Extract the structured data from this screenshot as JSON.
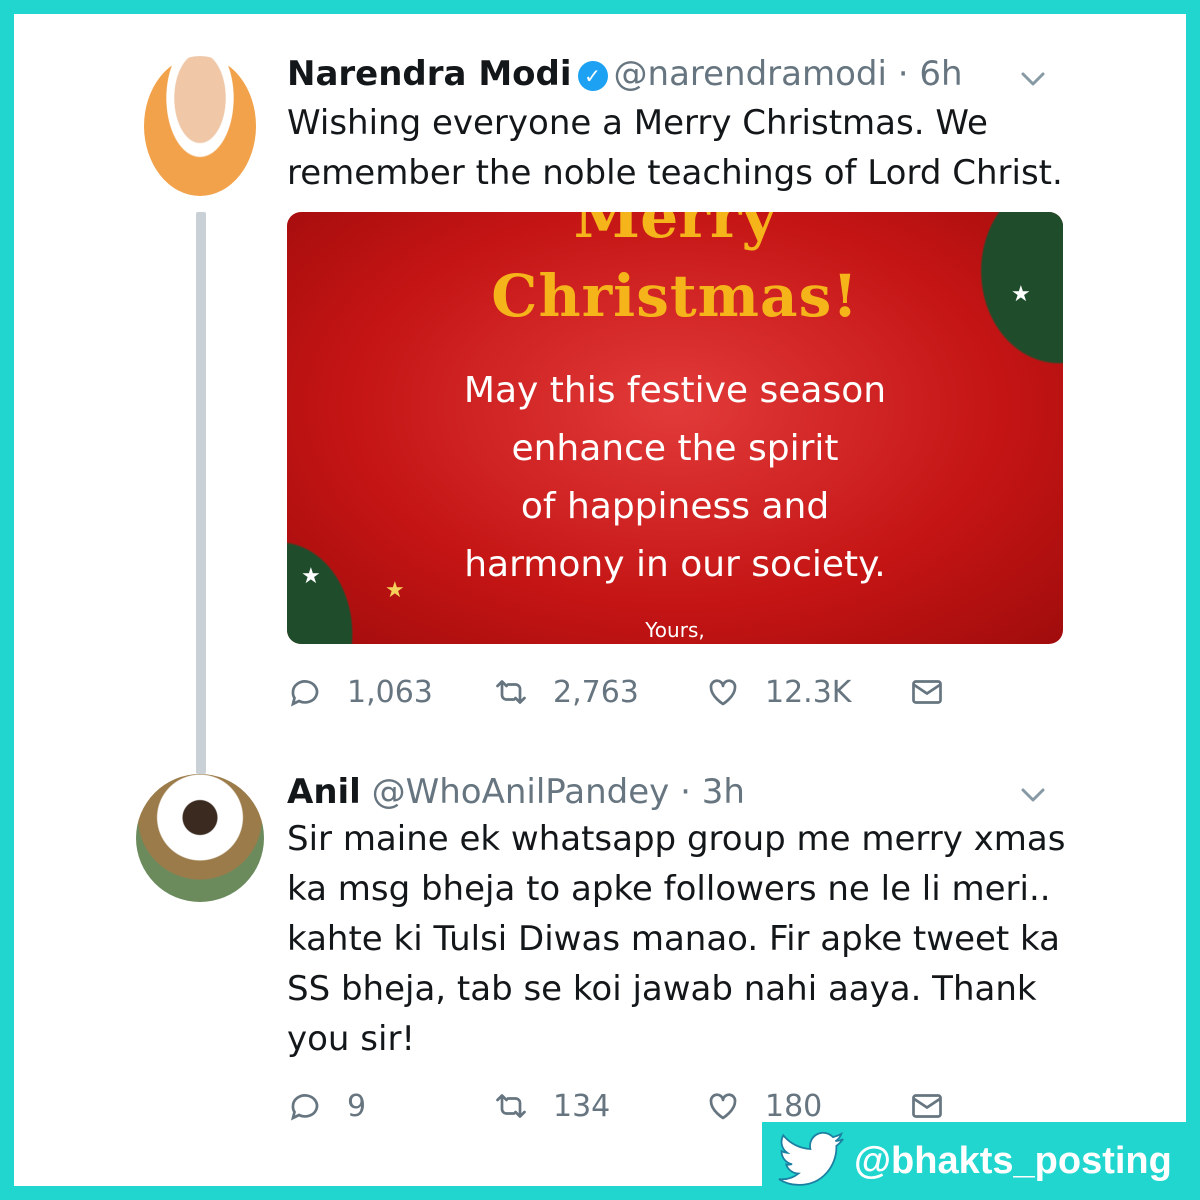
{
  "tweets": [
    {
      "name": "Narendra Modi",
      "handle": "@narendramodi",
      "sep": "·",
      "time": "6h",
      "text": "Wishing everyone a Merry Christmas. We remember the noble teachings of Lord Christ.",
      "media": {
        "line1": "Merry",
        "line2": "Christmas!",
        "message_lines": [
          "May this festive season",
          "enhance the spirit",
          "of happiness and",
          "harmony in our society."
        ],
        "signoff": "Yours,"
      },
      "replies": "1,063",
      "retweets": "2,763",
      "likes": "12.3K"
    },
    {
      "name": "Anil",
      "handle": "@WhoAnilPandey",
      "sep": "·",
      "time": "3h",
      "text_lines": [
        "Sir maine ek whatsapp group me merry xmas",
        "ka msg bheja to apke followers ne le li meri..",
        "kahte ki Tulsi Diwas manao. Fir apke tweet ka",
        "SS bheja, tab se koi jawab nahi aaya. Thank",
        "you sir!"
      ],
      "replies": "9",
      "retweets": "134",
      "likes": "180"
    }
  ],
  "watermark": {
    "handle": "@bhakts_posting",
    "icon": "twitter-bird-icon"
  },
  "colors": {
    "border": "#20d6cf",
    "text_secondary": "#66757f",
    "verified": "#1da1f2",
    "card_red": "#c41414",
    "card_gold": "#f5b41a"
  }
}
